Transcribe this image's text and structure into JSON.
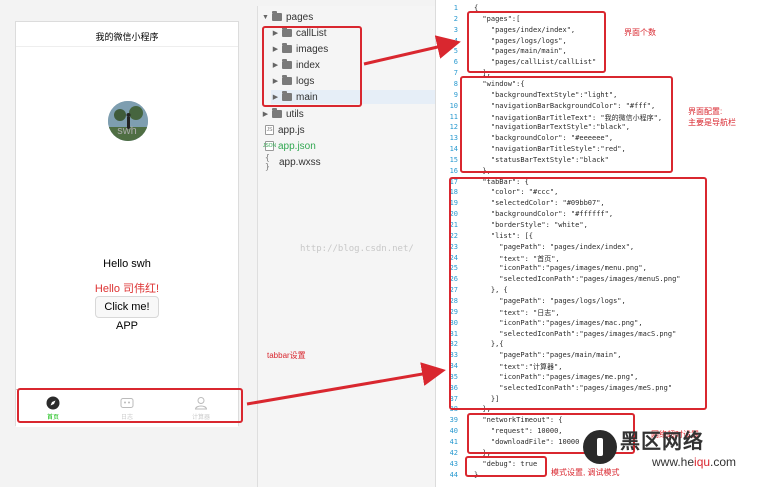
{
  "phone": {
    "title": "我的微信小程序",
    "nickname": "swh",
    "hello": "Hello swh",
    "hello_red": "Hello 司伟红!",
    "button_label": "Click me!",
    "app_text": "APP",
    "tabs": [
      {
        "label": "首页",
        "icon": "compass-icon",
        "active": true
      },
      {
        "label": "日志",
        "icon": "mac-icon",
        "active": false
      },
      {
        "label": "计算器",
        "icon": "person-icon",
        "active": false
      }
    ],
    "colors": {
      "active": "#09bb07",
      "inactive": "#cccccc"
    }
  },
  "tree": {
    "root": "pages",
    "items": [
      {
        "label": "callList",
        "type": "folder"
      },
      {
        "label": "images",
        "type": "folder"
      },
      {
        "label": "index",
        "type": "folder"
      },
      {
        "label": "logs",
        "type": "folder"
      },
      {
        "label": "main",
        "type": "folder"
      }
    ],
    "utils": "utils",
    "files": [
      {
        "label": "app.js",
        "tag": "JS"
      },
      {
        "label": "app.json",
        "tag": "JSON"
      },
      {
        "label": "app.wxss",
        "tag": "{ }"
      }
    ]
  },
  "editor": {
    "line_numbers": [
      "1",
      "2",
      "3",
      "4",
      "5",
      "6",
      "7",
      "8",
      "9",
      "10",
      "11",
      "12",
      "13",
      "14",
      "15",
      "16",
      "17",
      "18",
      "19",
      "20",
      "21",
      "22",
      "23",
      "24",
      "25",
      "26",
      "27",
      "28",
      "29",
      "30",
      "31",
      "32",
      "33",
      "34",
      "35",
      "36",
      "37",
      "38",
      "39",
      "40",
      "41",
      "42",
      "43",
      "44"
    ],
    "lines": [
      "{",
      "  \"pages\":[",
      "    \"pages/index/index\",",
      "    \"pages/logs/logs\",",
      "    \"pages/main/main\",",
      "    \"pages/callList/callList\"",
      "  ],",
      "  \"window\":{",
      "    \"backgroundTextStyle\":\"light\",",
      "    \"navigationBarBackgroundColor\": \"#fff\",",
      "    \"navigationBarTitleText\": \"我的微信小程序\",",
      "    \"navigationBarTextStyle\":\"black\",",
      "    \"backgroundColor\": \"#eeeeee\",",
      "    \"navigationBarTitleStyle\":\"red\",",
      "    \"statusBarTextStyle\":\"black\"",
      "  },",
      "  \"tabBar\": {",
      "    \"color\": \"#ccc\",",
      "    \"selectedColor\": \"#09bb07\",",
      "    \"backgroundColor\": \"#ffffff\",",
      "    \"borderStyle\": \"white\",",
      "    \"list\": [{",
      "      \"pagePath\": \"pages/index/index\",",
      "      \"text\": \"首页\",",
      "      \"iconPath\":\"pages/images/menu.png\",",
      "      \"selectedIconPath\":\"pages/images/menuS.png\"",
      "    }, {",
      "      \"pagePath\": \"pages/logs/logs\",",
      "      \"text\": \"日志\",",
      "      \"iconPath\":\"pages/images/mac.png\",",
      "      \"selectedIconPath\":\"pages/images/macS.png\"",
      "    },{",
      "      \"pagePath\":\"pages/main/main\",",
      "      \"text\":\"计算器\",",
      "      \"iconPath\":\"pages/images/me.png\",",
      "      \"selectedIconPath\":\"pages/images/meS.png\"",
      "    }]",
      "  },",
      "  \"networkTimeout\": {",
      "    \"request\": 10000,",
      "    \"downloadFile\": 10000",
      "  },",
      "  \"debug\": true",
      "}"
    ]
  },
  "annotations": {
    "pages_note": "界面个数",
    "window_note_1": "界面配置:",
    "window_note_2": "主要是导航栏",
    "tabbar_note": "tabbar设置",
    "network_note": "网络超时设置",
    "debug_note": "模式设置, 调试模式"
  },
  "watermark": "http://blog.csdn.net/",
  "brand": {
    "name": "黑区网络",
    "url_prefix": "www.he",
    "url_accent": "iqu",
    "url_suffix": ".com"
  }
}
